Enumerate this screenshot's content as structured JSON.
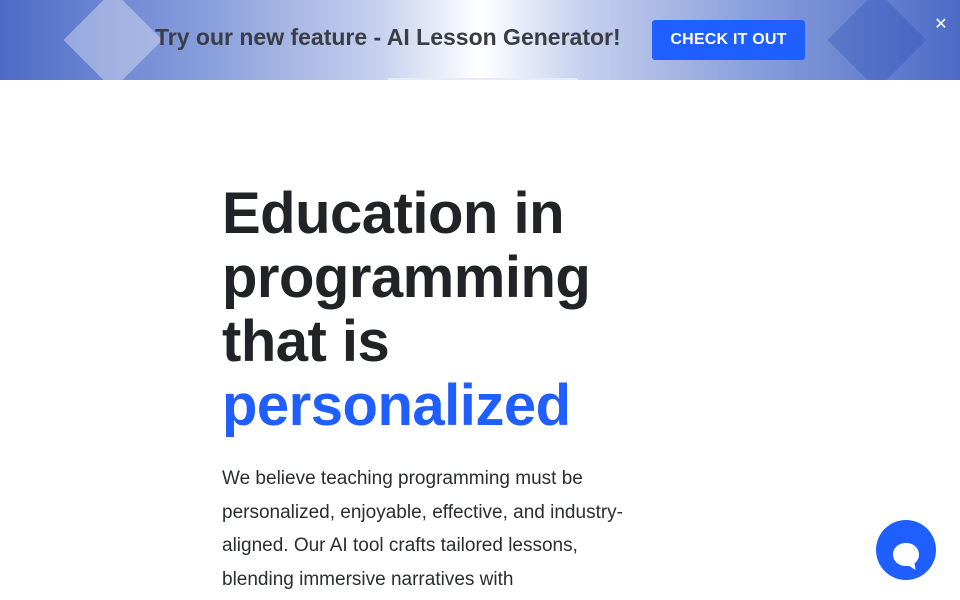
{
  "banner": {
    "text": "Try our new feature - AI Lesson Generator!",
    "cta_label": "CHECK IT OUT",
    "close_glyph": "✕"
  },
  "hero": {
    "title_lines": [
      "Education in",
      "programming",
      "that is"
    ],
    "title_accent": "personalized",
    "description": "We believe teaching programming must be personalized, enjoyable, effective, and industry-aligned. Our AI tool crafts tailored lessons, blending immersive narratives with"
  },
  "chat": {
    "icon": "chat-bubble-icon"
  },
  "colors": {
    "accent": "#1f5eff",
    "heading": "#222326",
    "banner_text": "#3a3d45"
  }
}
